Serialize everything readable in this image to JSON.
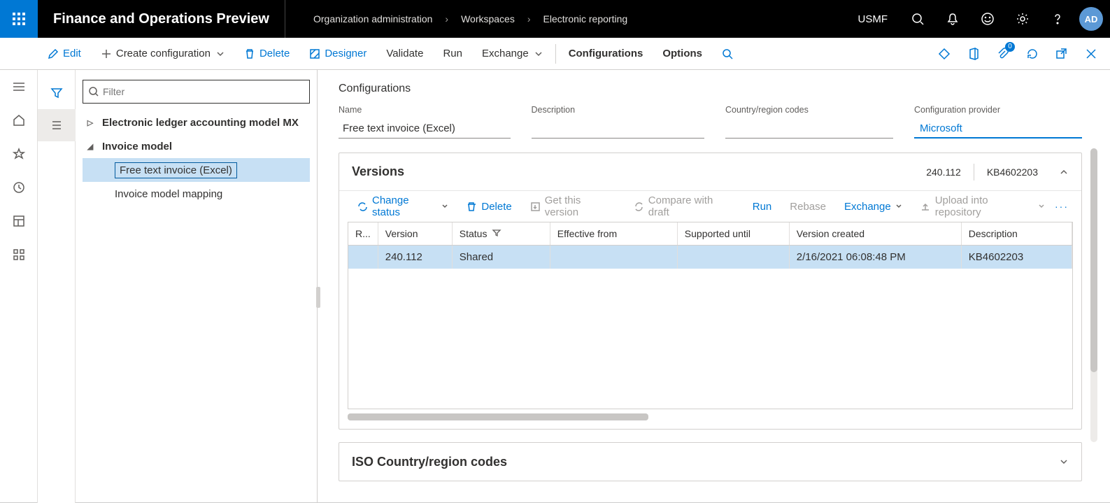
{
  "topbar": {
    "app_title": "Finance and Operations Preview",
    "breadcrumb": [
      "Organization administration",
      "Workspaces",
      "Electronic reporting"
    ],
    "company": "USMF",
    "avatar_initials": "AD"
  },
  "commandbar": {
    "edit": "Edit",
    "create_config": "Create configuration",
    "delete": "Delete",
    "designer": "Designer",
    "validate": "Validate",
    "run": "Run",
    "exchange": "Exchange",
    "configurations": "Configurations",
    "options": "Options",
    "badge_count": "0"
  },
  "tree": {
    "filter_placeholder": "Filter",
    "root1": "Electronic ledger accounting model MX",
    "root2": "Invoice model",
    "child_selected": "Free text invoice (Excel)",
    "child2": "Invoice model mapping"
  },
  "detail": {
    "section_label": "Configurations",
    "fields": {
      "name_label": "Name",
      "name_value": "Free text invoice (Excel)",
      "description_label": "Description",
      "description_value": "",
      "country_label": "Country/region codes",
      "country_value": "",
      "provider_label": "Configuration provider",
      "provider_value": "Microsoft"
    }
  },
  "versions": {
    "title": "Versions",
    "summary_version": "240.112",
    "summary_desc": "KB4602203",
    "toolbar": {
      "change_status": "Change status",
      "delete": "Delete",
      "get_version": "Get this version",
      "compare": "Compare with draft",
      "run": "Run",
      "rebase": "Rebase",
      "exchange": "Exchange",
      "upload": "Upload into repository"
    },
    "columns": {
      "r": "R...",
      "version": "Version",
      "status": "Status",
      "effective": "Effective from",
      "supported": "Supported until",
      "created": "Version created",
      "description": "Description"
    },
    "rows": [
      {
        "version": "240.112",
        "status": "Shared",
        "effective": "",
        "supported": "",
        "created": "2/16/2021 06:08:48 PM",
        "description": "KB4602203"
      }
    ]
  },
  "iso": {
    "title": "ISO Country/region codes"
  }
}
